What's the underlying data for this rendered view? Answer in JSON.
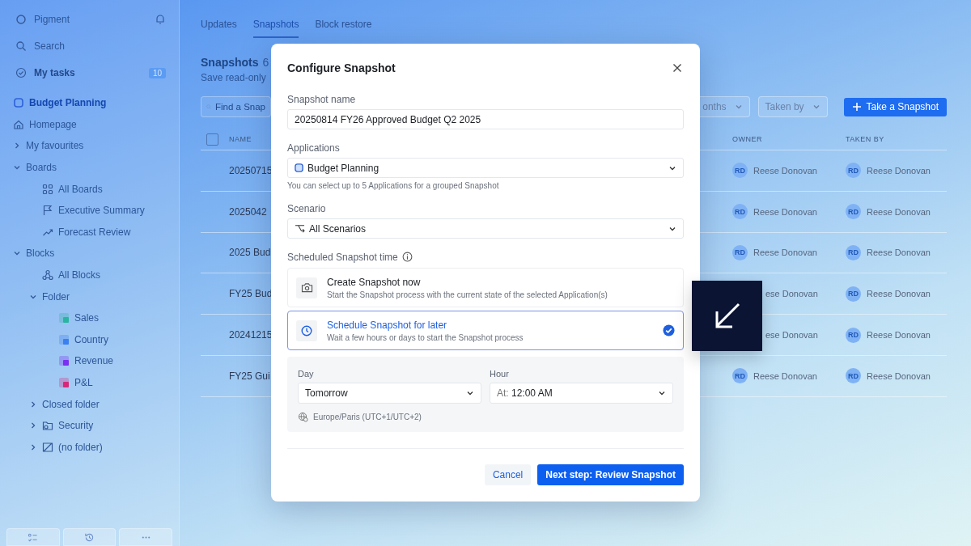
{
  "sidebar": {
    "workspace": "Pigment",
    "search_placeholder": "Search",
    "tasks": {
      "label": "My tasks",
      "badge": "10"
    },
    "items": [
      {
        "label": "Budget Planning",
        "kind": "app",
        "selected": true
      },
      {
        "label": "Homepage",
        "kind": "home",
        "selected": false
      },
      {
        "label": "My favourites",
        "kind": "group",
        "expanded": false,
        "selected": false
      },
      {
        "label": "Boards",
        "kind": "group",
        "expanded": true,
        "selected": false,
        "children": [
          {
            "label": "All Boards",
            "kind": "grid",
            "selected": false
          },
          {
            "label": "Executive Summary",
            "kind": "flag",
            "selected": false
          },
          {
            "label": "Forecast Review",
            "kind": "trend",
            "selected": false
          }
        ]
      },
      {
        "label": "Blocks",
        "kind": "group",
        "expanded": true,
        "selected": false,
        "children": [
          {
            "label": "All Blocks",
            "kind": "blocks",
            "selected": false
          },
          {
            "label": "Folder",
            "kind": "group",
            "expanded": true,
            "selected": false,
            "children": [
              {
                "label": "Sales",
                "kind": "block",
                "color": "#2bb3a3",
                "selected": false
              },
              {
                "label": "Country",
                "kind": "block",
                "color": "#3b7ff0",
                "selected": false
              },
              {
                "label": "Revenue",
                "kind": "block",
                "color": "#7b2ff0",
                "selected": false
              },
              {
                "label": "P&L",
                "kind": "block",
                "color": "#d6287a",
                "selected": false
              }
            ]
          },
          {
            "label": "Closed folder",
            "kind": "group",
            "expanded": false,
            "selected": false
          },
          {
            "label": "Security",
            "kind": "security-folder",
            "expanded": false,
            "selected": false
          },
          {
            "label": "(no folder)",
            "kind": "no-folder",
            "expanded": false,
            "selected": false
          }
        ]
      }
    ]
  },
  "tabs": [
    {
      "label": "Updates",
      "selected": false
    },
    {
      "label": "Snapshots",
      "selected": true
    },
    {
      "label": "Block restore",
      "selected": false
    }
  ],
  "header": {
    "title": "Snapshots",
    "count": "6",
    "subtitle": "Save read-only"
  },
  "search": {
    "placeholder": "Find a Snap"
  },
  "filters": [
    "onths",
    "Taken by"
  ],
  "primary_button": "Take a Snapshot",
  "table": {
    "select_all_checked": false,
    "columns": [
      "NAME",
      "OWNER",
      "TAKEN BY"
    ],
    "rows": [
      {
        "name": "20250715",
        "owner": {
          "initials": "RD",
          "name": "Reese Donovan"
        },
        "taken_by": {
          "initials": "RD",
          "name": "Reese Donovan"
        }
      },
      {
        "name": "2025042",
        "owner": {
          "initials": "RD",
          "name": "Reese Donovan"
        },
        "taken_by": {
          "initials": "RD",
          "name": "Reese Donovan"
        }
      },
      {
        "name": "2025 Bud",
        "owner": {
          "initials": "RD",
          "name": "Reese Donovan"
        },
        "taken_by": {
          "initials": "RD",
          "name": "Reese Donovan"
        }
      },
      {
        "name": "FY25 Bud",
        "owner": {
          "name": "ese Donovan"
        },
        "taken_by": {
          "initials": "RD",
          "name": "Reese Donovan"
        }
      },
      {
        "name": "20241215",
        "owner": {
          "name": "ese Donovan"
        },
        "taken_by": {
          "initials": "RD",
          "name": "Reese Donovan"
        }
      },
      {
        "name": "FY25 Gui",
        "owner": {
          "initials": "RD",
          "name": "Reese Donovan"
        },
        "taken_by": {
          "initials": "RD",
          "name": "Reese Donovan"
        }
      }
    ]
  },
  "modal": {
    "title": "Configure Snapshot",
    "name_field": {
      "label": "Snapshot name",
      "value": "20250814 FY26 Approved Budget Q2 2025"
    },
    "applications": {
      "label": "Applications",
      "value": "Budget Planning",
      "hint": "You can select up to 5 Applications for a grouped Snapshot"
    },
    "scenario": {
      "label": "Scenario",
      "value": "All Scenarios"
    },
    "schedule": {
      "label": "Scheduled Snapshot time",
      "options": [
        {
          "kind": "camera",
          "title": "Create Snapshot now",
          "description": "Start the Snapshot process with the current state of the selected Application(s)",
          "selected": false
        },
        {
          "kind": "clock",
          "title": "Schedule Snapshot for later",
          "description": "Wait a few hours or days to start the Snapshot process",
          "selected": true
        }
      ]
    },
    "day": {
      "label": "Day",
      "value": "Tomorrow"
    },
    "hour": {
      "label": "Hour",
      "prefix": "At:",
      "value": "12:00 AM"
    },
    "timezone": "Europe/Paris (UTC+1/UTC+2)",
    "cancel": "Cancel",
    "next": "Next step: Review Snapshot"
  }
}
